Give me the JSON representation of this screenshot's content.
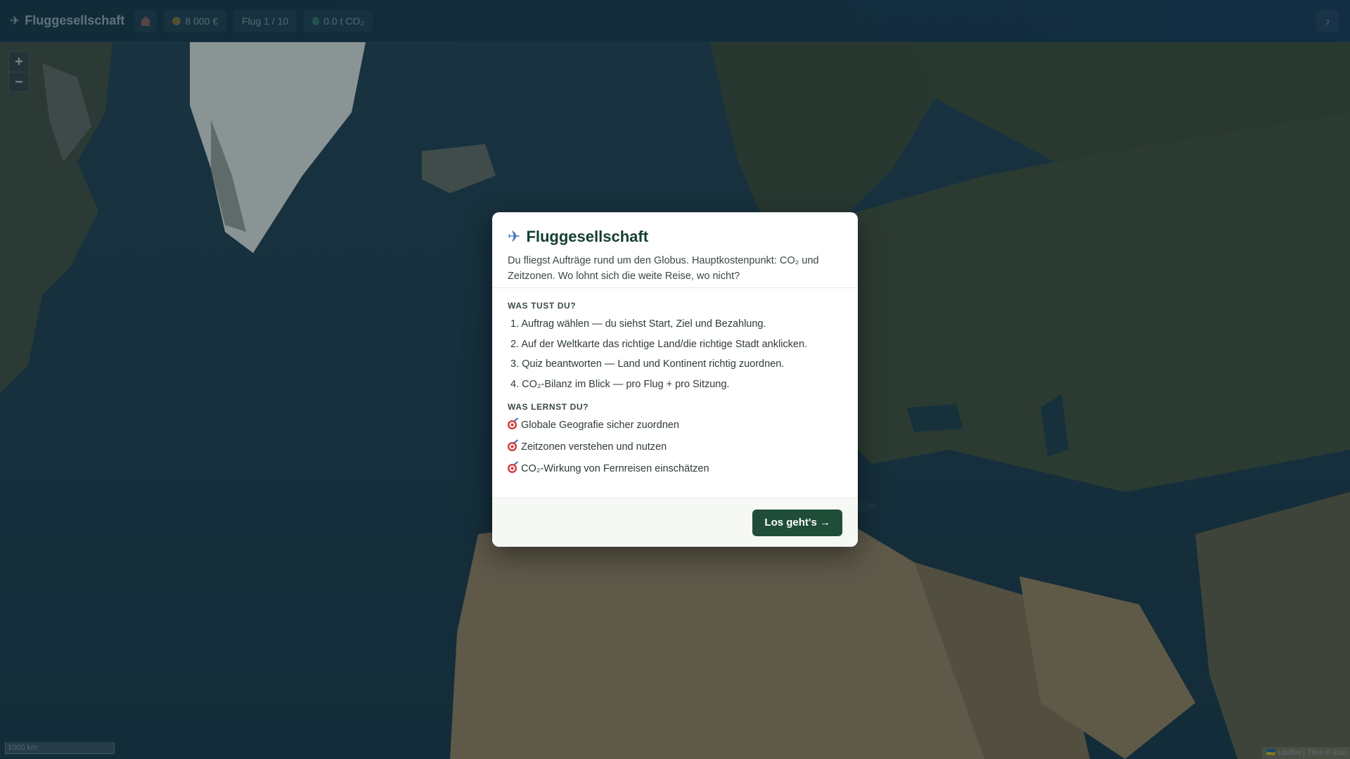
{
  "topbar": {
    "brand": "Fluggesellschaft",
    "brand_icon": "airplane-icon",
    "budget": "8 000 €",
    "flight": "Flug 1 / 10",
    "co2": "0.0 t CO₂"
  },
  "map": {
    "zoom_in": "+",
    "zoom_out": "−",
    "scale_label": "1000 km",
    "attribution": "🇺🇦 Leaflet | Tiles © Esri"
  },
  "modal": {
    "title": "Fluggesellschaft",
    "subtitle": "Du fliegst Aufträge rund um den Globus. Hauptkostenpunkt: CO₂ und Zeitzonen. Wo lohnt sich die weite Reise, wo nicht?",
    "what_heading": "WAS TUST DU?",
    "steps": [
      "1. Auftrag wählen — du siehst Start, Ziel und Bezahlung.",
      "2. Auf der Weltkarte das richtige Land/die richtige Stadt anklicken.",
      "3. Quiz beantworten — Land und Kontinent richtig zuordnen.",
      "4. CO₂-Bilanz im Blick — pro Flug + pro Sitzung."
    ],
    "learn_heading": "WAS LERNST DU?",
    "goals": [
      "Globale Geografie sicher zuordnen",
      "Zeitzonen verstehen und nutzen",
      "CO₂-Wirkung von Fernreisen einschätzen"
    ],
    "start_button": "Los geht's →"
  },
  "colors": {
    "ocean": "#1d3b4c",
    "land": "#3c4a3a",
    "ice": "#d8dcdc",
    "desert": "#9a8466",
    "modal_accent": "#1f4d38"
  }
}
